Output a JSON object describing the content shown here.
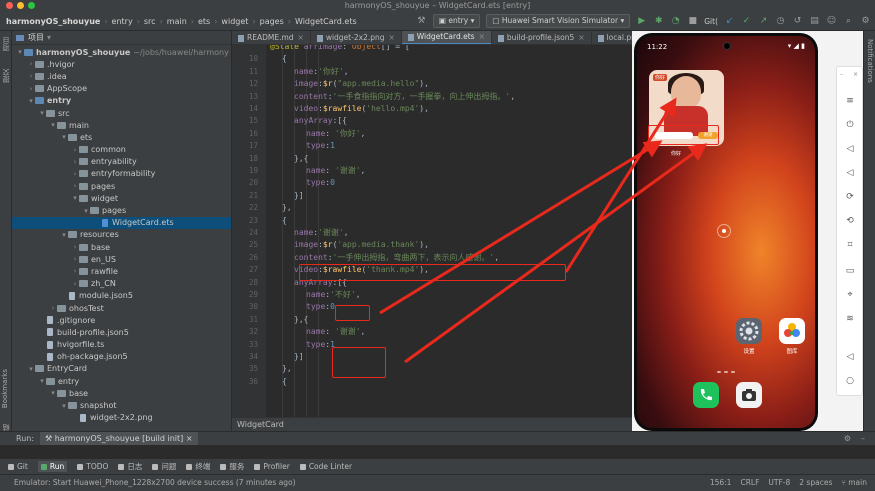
{
  "window": {
    "title": "harmonyOS_shouyue – WidgetCard.ets [entry]"
  },
  "breadcrumb": [
    "harmonyOS_shouyue",
    "entry",
    "src",
    "main",
    "ets",
    "widget",
    "pages",
    "WidgetCard.ets"
  ],
  "toolbar": {
    "module_combo": "entry",
    "device_combo": "Huawei Smart Vision Simulator",
    "git_label": "Git("
  },
  "side_labels": {
    "project": "项目",
    "commit": "提交",
    "bookmarks": "Bookmarks",
    "structure": "结构",
    "notifications": "Notifications"
  },
  "project_panel": {
    "title": "项目",
    "tree": [
      {
        "depth": 0,
        "arrow": "▾",
        "icon": "folder-blue",
        "label": "harmonyOS_shouyue",
        "muted": "~/jobs/huawei/harmony",
        "bold": true
      },
      {
        "depth": 1,
        "arrow": "›",
        "icon": "folder",
        "label": ".hvigor"
      },
      {
        "depth": 1,
        "arrow": "›",
        "icon": "folder",
        "label": ".idea"
      },
      {
        "depth": 1,
        "arrow": "›",
        "icon": "folder",
        "label": "AppScope"
      },
      {
        "depth": 1,
        "arrow": "▾",
        "icon": "folder-blue",
        "label": "entry",
        "bold": true
      },
      {
        "depth": 2,
        "arrow": "▾",
        "icon": "folder",
        "label": "src"
      },
      {
        "depth": 3,
        "arrow": "▾",
        "icon": "folder",
        "label": "main"
      },
      {
        "depth": 4,
        "arrow": "▾",
        "icon": "folder",
        "label": "ets"
      },
      {
        "depth": 5,
        "arrow": "›",
        "icon": "folder",
        "label": "common"
      },
      {
        "depth": 5,
        "arrow": "›",
        "icon": "folder",
        "label": "entryability"
      },
      {
        "depth": 5,
        "arrow": "›",
        "icon": "folder",
        "label": "entryformability"
      },
      {
        "depth": 5,
        "arrow": "›",
        "icon": "folder",
        "label": "pages"
      },
      {
        "depth": 5,
        "arrow": "▾",
        "icon": "folder",
        "label": "widget"
      },
      {
        "depth": 6,
        "arrow": "▾",
        "icon": "folder",
        "label": "pages"
      },
      {
        "depth": 7,
        "arrow": "",
        "icon": "ets",
        "label": "WidgetCard.ets",
        "selected": true
      },
      {
        "depth": 4,
        "arrow": "▾",
        "icon": "folder",
        "label": "resources"
      },
      {
        "depth": 5,
        "arrow": "›",
        "icon": "folder",
        "label": "base"
      },
      {
        "depth": 5,
        "arrow": "›",
        "icon": "folder",
        "label": "en_US"
      },
      {
        "depth": 5,
        "arrow": "›",
        "icon": "folder",
        "label": "rawfile"
      },
      {
        "depth": 5,
        "arrow": "›",
        "icon": "folder",
        "label": "zh_CN"
      },
      {
        "depth": 4,
        "arrow": "",
        "icon": "file",
        "label": "module.json5"
      },
      {
        "depth": 3,
        "arrow": "›",
        "icon": "folder",
        "label": "ohosTest"
      },
      {
        "depth": 2,
        "arrow": "",
        "icon": "file",
        "label": ".gitignore"
      },
      {
        "depth": 2,
        "arrow": "",
        "icon": "file",
        "label": "build-profile.json5"
      },
      {
        "depth": 2,
        "arrow": "",
        "icon": "file",
        "label": "hvigorfile.ts"
      },
      {
        "depth": 2,
        "arrow": "",
        "icon": "file",
        "label": "oh-package.json5"
      },
      {
        "depth": 1,
        "arrow": "▾",
        "icon": "folder",
        "label": "EntryCard"
      },
      {
        "depth": 2,
        "arrow": "▾",
        "icon": "folder",
        "label": "entry"
      },
      {
        "depth": 3,
        "arrow": "▾",
        "icon": "folder",
        "label": "base"
      },
      {
        "depth": 4,
        "arrow": "▾",
        "icon": "folder",
        "label": "snapshot"
      },
      {
        "depth": 5,
        "arrow": "",
        "icon": "file",
        "label": "widget-2x2.png"
      }
    ]
  },
  "editor_tabs": [
    {
      "label": "README.md",
      "active": false
    },
    {
      "label": "widget-2x2.png",
      "active": false
    },
    {
      "label": "WidgetCard.ets",
      "active": true
    },
    {
      "label": "build-profile.json5",
      "active": false
    },
    {
      "label": "local.properties",
      "active": false
    }
  ],
  "code_lines": [
    {
      "n": "",
      "tokens": [
        [
          "ann",
          "@State "
        ],
        [
          "prop",
          "arrImage"
        ],
        [
          "",
          ": "
        ],
        [
          "k",
          "Object"
        ],
        [
          "",
          "[] = ["
        ]
      ],
      "indent": 1
    },
    {
      "n": "10",
      "tokens": [
        [
          "",
          "{"
        ]
      ],
      "indent": 2
    },
    {
      "n": "11",
      "tokens": [
        [
          "prop",
          "name"
        ],
        [
          "",
          ":"
        ],
        [
          "str",
          "'你好'"
        ],
        [
          "",
          ","
        ]
      ],
      "indent": 3
    },
    {
      "n": "12",
      "tokens": [
        [
          "prop",
          "image"
        ],
        [
          "",
          ":"
        ],
        [
          "fn",
          "$r"
        ],
        [
          "",
          "("
        ],
        [
          "str",
          "\"app.media.hello\""
        ],
        [
          "",
          "),"
        ]
      ],
      "indent": 3
    },
    {
      "n": "13",
      "tokens": [
        [
          "prop",
          "content"
        ],
        [
          "",
          ":"
        ],
        [
          "str",
          "'一手食指指向对方，一手握拳，向上伸出拇指。'"
        ],
        [
          "",
          ","
        ]
      ],
      "indent": 3
    },
    {
      "n": "14",
      "tokens": [
        [
          "prop",
          "video"
        ],
        [
          "",
          ":"
        ],
        [
          "fn",
          "$rawfile"
        ],
        [
          "",
          "("
        ],
        [
          "str",
          "'hello.mp4'"
        ],
        [
          "",
          "),"
        ]
      ],
      "indent": 3
    },
    {
      "n": "15",
      "tokens": [
        [
          "prop",
          "anyArray"
        ],
        [
          "",
          ":[{"
        ]
      ],
      "indent": 3
    },
    {
      "n": "16",
      "tokens": [
        [
          "prop",
          "name"
        ],
        [
          "",
          ": "
        ],
        [
          "str",
          "'你好'"
        ],
        [
          "",
          ","
        ]
      ],
      "indent": 4
    },
    {
      "n": "17",
      "tokens": [
        [
          "prop",
          "type"
        ],
        [
          "",
          ":"
        ],
        [
          "num",
          "1"
        ]
      ],
      "indent": 4
    },
    {
      "n": "18",
      "tokens": [
        [
          "",
          "},{"
        ]
      ],
      "indent": 3
    },
    {
      "n": "19",
      "tokens": [
        [
          "prop",
          "name"
        ],
        [
          "",
          ": "
        ],
        [
          "str",
          "'谢谢'"
        ],
        [
          "",
          ","
        ]
      ],
      "indent": 4
    },
    {
      "n": "20",
      "tokens": [
        [
          "prop",
          "type"
        ],
        [
          "",
          ":"
        ],
        [
          "num",
          "0"
        ]
      ],
      "indent": 4
    },
    {
      "n": "21",
      "tokens": [
        [
          "",
          "}]"
        ]
      ],
      "indent": 3
    },
    {
      "n": "22",
      "tokens": [
        [
          "",
          "},"
        ]
      ],
      "indent": 2
    },
    {
      "n": "23",
      "tokens": [
        [
          "",
          "{"
        ]
      ],
      "indent": 2
    },
    {
      "n": "24",
      "tokens": [
        [
          "prop",
          "name"
        ],
        [
          "",
          ":"
        ],
        [
          "str",
          "'谢谢'"
        ],
        [
          "",
          ","
        ]
      ],
      "indent": 3
    },
    {
      "n": "25",
      "tokens": [
        [
          "prop",
          "image"
        ],
        [
          "",
          ":"
        ],
        [
          "fn",
          "$r"
        ],
        [
          "",
          "("
        ],
        [
          "str",
          "'app.media.thank'"
        ],
        [
          "",
          "),"
        ]
      ],
      "indent": 3
    },
    {
      "n": "26",
      "tokens": [
        [
          "prop",
          "content"
        ],
        [
          "",
          ":"
        ],
        [
          "str",
          "'一手伸出拇指，弯曲两下，表示向人感谢。'"
        ],
        [
          "",
          ","
        ]
      ],
      "indent": 3
    },
    {
      "n": "27",
      "tokens": [
        [
          "prop",
          "video"
        ],
        [
          "",
          ":"
        ],
        [
          "fn",
          "$rawfile"
        ],
        [
          "",
          "("
        ],
        [
          "str",
          "'thank.mp4'"
        ],
        [
          "",
          "),"
        ]
      ],
      "indent": 3
    },
    {
      "n": "28",
      "tokens": [
        [
          "prop",
          "anyArray"
        ],
        [
          "",
          ":[{"
        ]
      ],
      "indent": 3
    },
    {
      "n": "29",
      "tokens": [
        [
          "prop",
          "name"
        ],
        [
          "",
          ":"
        ],
        [
          "str",
          "'不好'"
        ],
        [
          "",
          ","
        ]
      ],
      "indent": 4
    },
    {
      "n": "30",
      "tokens": [
        [
          "prop",
          "type"
        ],
        [
          "",
          ":"
        ],
        [
          "num",
          "0"
        ]
      ],
      "indent": 4
    },
    {
      "n": "31",
      "tokens": [
        [
          "",
          "},{"
        ]
      ],
      "indent": 3
    },
    {
      "n": "32",
      "tokens": [
        [
          "prop",
          "name"
        ],
        [
          "",
          ": "
        ],
        [
          "str",
          "'谢谢'"
        ],
        [
          "",
          ","
        ]
      ],
      "indent": 4
    },
    {
      "n": "33",
      "tokens": [
        [
          "prop",
          "type"
        ],
        [
          "",
          ":"
        ],
        [
          "num",
          "1"
        ]
      ],
      "indent": 4
    },
    {
      "n": "34",
      "tokens": [
        [
          "",
          "}]"
        ]
      ],
      "indent": 3
    },
    {
      "n": "35",
      "tokens": [
        [
          "",
          "},"
        ]
      ],
      "indent": 2
    },
    {
      "n": "36",
      "tokens": [
        [
          "",
          "{"
        ]
      ],
      "indent": 2
    }
  ],
  "editor_footer": "WidgetCard",
  "phone": {
    "time": "11:22",
    "status_right": "▾ ◢ ▮",
    "card_badge": "你好",
    "card_button": "谢谢",
    "card_caption": "你好",
    "apps": [
      {
        "name": "设置"
      },
      {
        "name": "图库"
      }
    ]
  },
  "run_bar": {
    "label": "Run:",
    "tab": "harmonyOS_shouyue [build init]"
  },
  "tool_windows": [
    {
      "label": "Git",
      "active": false
    },
    {
      "label": "Run",
      "active": true
    },
    {
      "label": "TODO",
      "active": false
    },
    {
      "label": "日志",
      "active": false
    },
    {
      "label": "问题",
      "active": false
    },
    {
      "label": "终端",
      "active": false
    },
    {
      "label": "服务",
      "active": false
    },
    {
      "label": "Profiler",
      "active": false
    },
    {
      "label": "Code Linter",
      "active": false
    }
  ],
  "status_bar": {
    "message": "Emulator: Start Huawei_Phone_1228x2700 device success (7 minutes ago)",
    "position": "156:1",
    "line_sep": "CRLF",
    "encoding": "UTF-8",
    "indent": "2 spaces",
    "branch": "main"
  }
}
